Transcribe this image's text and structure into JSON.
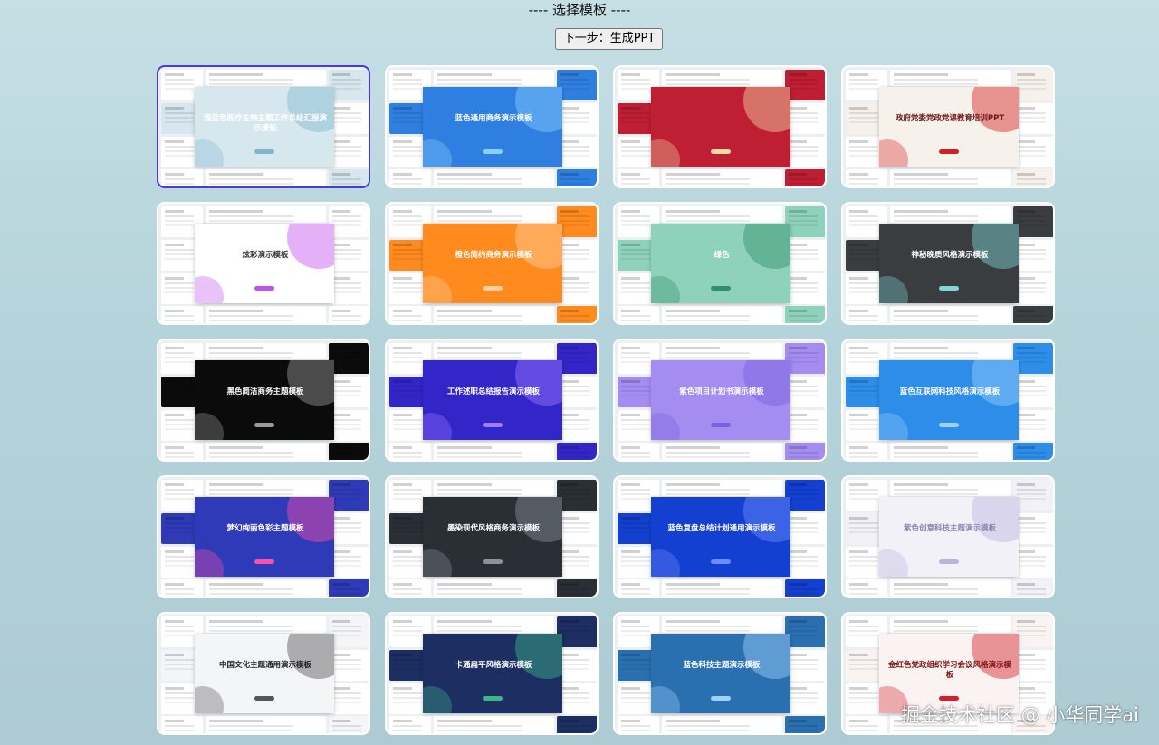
{
  "page": {
    "title": "---- 选择模板 ----",
    "next_button": "下一步：生成PPT"
  },
  "templates": [
    {
      "name": "浅蓝色医疗生物主题工作总结汇报演示模板",
      "bg": "#d7e7ee",
      "fg": "#ffffff",
      "accent": "#7fb7cf",
      "selected": true
    },
    {
      "name": "蓝色通用商务演示模板",
      "bg": "#2f7fe0",
      "fg": "#ffffff",
      "accent": "#8ad0ff",
      "selected": false
    },
    {
      "name": "",
      "bg": "#bf1f32",
      "fg": "#ffffff",
      "accent": "#f2d7a8",
      "selected": false
    },
    {
      "name": "政府党委党政党课教育培训PPT",
      "bg": "#f7f1ec",
      "fg": "#6b1a1a",
      "accent": "#d42020",
      "selected": false
    },
    {
      "name": "炫彩演示模板",
      "bg": "#ffffff",
      "fg": "#333333",
      "accent": "#c44ff0",
      "selected": false
    },
    {
      "name": "橙色简约商务演示模板",
      "bg": "#ff8a1e",
      "fg": "#ffffff",
      "accent": "#ffd1a0",
      "selected": false
    },
    {
      "name": "绿色",
      "bg": "#8fd2bc",
      "fg": "#ffffff",
      "accent": "#2e8f69",
      "selected": false
    },
    {
      "name": "神秘晚质风格演示模板",
      "bg": "#3a3d40",
      "fg": "#ffffff",
      "accent": "#7fd6d6",
      "selected": false
    },
    {
      "name": "黑色简洁商务主题模板",
      "bg": "#0b0b0b",
      "fg": "#ffffff",
      "accent": "#9a9a9a",
      "selected": false
    },
    {
      "name": "工作述职总结报告演示模板",
      "bg": "#3226c8",
      "fg": "#ffffff",
      "accent": "#9f7bff",
      "selected": false
    },
    {
      "name": "紫色项目计划书演示模板",
      "bg": "#a58cf0",
      "fg": "#ffffff",
      "accent": "#7a5fe0",
      "selected": false
    },
    {
      "name": "蓝色互联网科技风格演示模板",
      "bg": "#2d8de8",
      "fg": "#ffffff",
      "accent": "#9bd0ff",
      "selected": false
    },
    {
      "name": "梦幻绚丽色彩主题模板",
      "bg": "#2f3ab8",
      "fg": "#ffffff",
      "accent": "#ff4fa8",
      "selected": false
    },
    {
      "name": "墨染现代风格商务演示模板",
      "bg": "#2a2f36",
      "fg": "#ffffff",
      "accent": "#8a929c",
      "selected": false
    },
    {
      "name": "蓝色复盘总结计划通用演示模板",
      "bg": "#1340d0",
      "fg": "#ffffff",
      "accent": "#6f8dff",
      "selected": false
    },
    {
      "name": "紫色创意科技主题演示模板",
      "bg": "#f2f1f7",
      "fg": "#8a86b0",
      "accent": "#b9b3dd",
      "selected": false
    },
    {
      "name": "中国文化主题通用演示模板",
      "bg": "#f4f5f7",
      "fg": "#222222",
      "accent": "#555555",
      "selected": false
    },
    {
      "name": "卡通扁平风格演示模板",
      "bg": "#1c2e62",
      "fg": "#ffffff",
      "accent": "#3fb58b",
      "selected": false
    },
    {
      "name": "蓝色科技主题演示模板",
      "bg": "#2a6fb0",
      "fg": "#ffffff",
      "accent": "#9ed2ff",
      "selected": false
    },
    {
      "name": "金红色党政组织学习会议风格演示模板",
      "bg": "#fbf3f1",
      "fg": "#7a1515",
      "accent": "#d41f2a",
      "selected": false
    }
  ],
  "watermark": "掘金技术社区 @ 小华同学ai"
}
